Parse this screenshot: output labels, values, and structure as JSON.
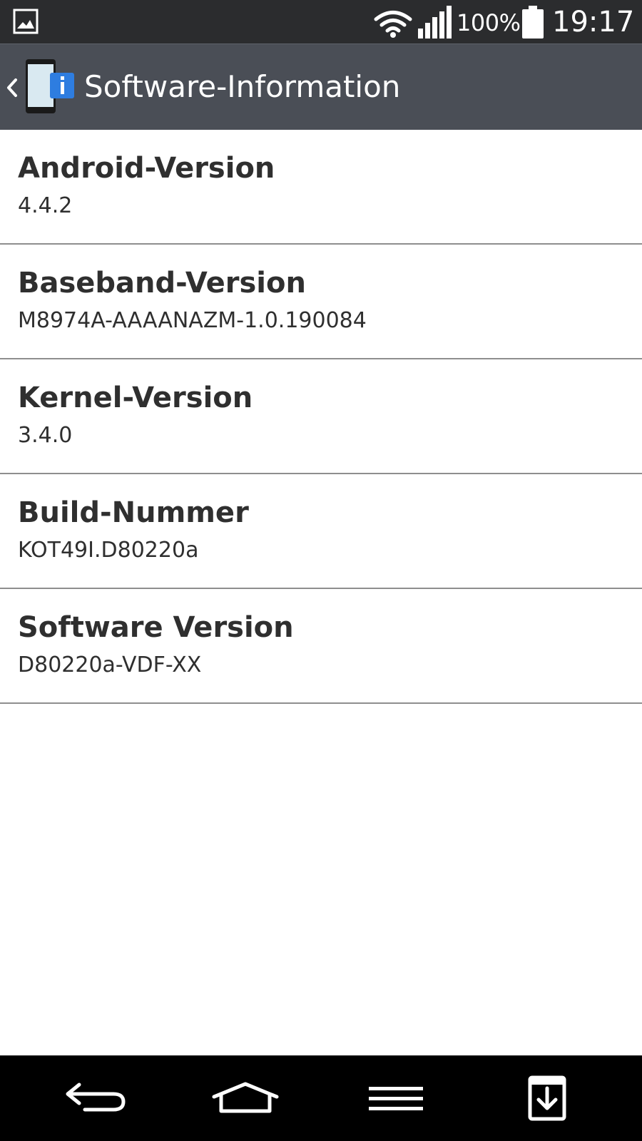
{
  "status_bar": {
    "notification_icon": "gallery-icon",
    "wifi_icon": "wifi-icon",
    "signal_icon": "signal-icon",
    "battery_percent": "100%",
    "battery_icon": "battery-icon",
    "time": "19:17"
  },
  "action_bar": {
    "back_icon": "chevron-left-icon",
    "app_icon": "phone-info-icon",
    "title": "Software-Information"
  },
  "info_items": [
    {
      "label": "Android-Version",
      "value": "4.4.2"
    },
    {
      "label": "Baseband-Version",
      "value": "M8974A-AAAANAZM-1.0.190084"
    },
    {
      "label": "Kernel-Version",
      "value": "3.4.0"
    },
    {
      "label": "Build-Nummer",
      "value": "KOT49I.D80220a"
    },
    {
      "label": "Software Version",
      "value": "D80220a-VDF-XX"
    }
  ],
  "nav_bar": {
    "back_icon": "back-arrow-icon",
    "home_icon": "home-icon",
    "menu_icon": "menu-icon",
    "notification_icon": "notification-drawer-icon"
  },
  "colors": {
    "status_bar_bg": "#2b2c2e",
    "action_bar_bg": "#4a4e56",
    "list_bg": "#ffffff",
    "divider": "#8e8e8e",
    "nav_bar_bg": "#000000",
    "info_badge": "#2e7de0"
  }
}
